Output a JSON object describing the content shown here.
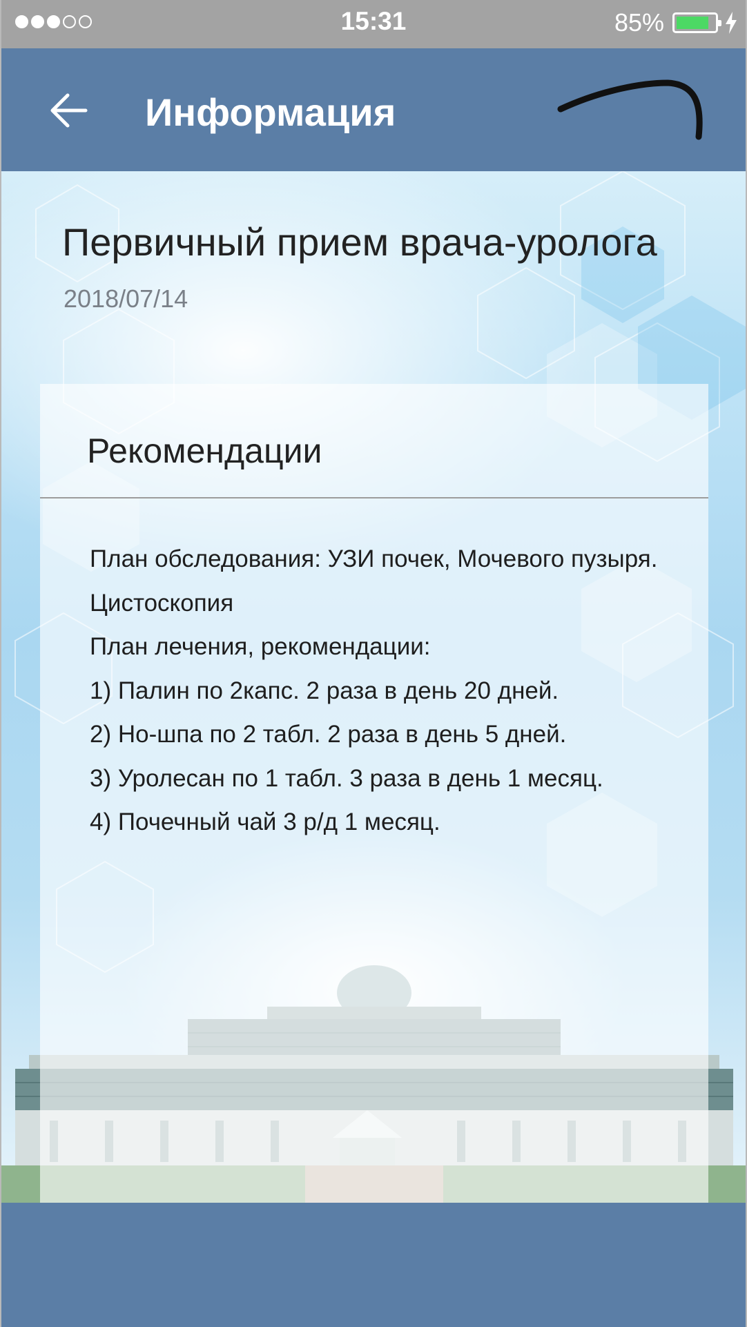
{
  "status_bar": {
    "time": "15:31",
    "battery_percent": "85%",
    "battery_level": 0.85,
    "signal_bars_filled": 3,
    "signal_bars_total": 5
  },
  "header": {
    "title": "Информация",
    "back_icon": "arrow-left-icon"
  },
  "document": {
    "title": "Первичный прием врача-уролога",
    "date": "2018/07/14"
  },
  "recommendations": {
    "heading": "Рекомендации",
    "lines": [
      "План обследования: УЗИ почек, Мочевого пузыря.",
      "Цистоскопия",
      "План лечения, рекомендации:",
      "1) Палин по 2капс. 2 раза в день 20 дней.",
      "2) Но-шпа по 2 табл. 2 раза в день 5 дней.",
      "3) Уролесан по 1 табл. 3 раза в день 1 месяц.",
      "4) Почечный чай 3 р/д 1 месяц."
    ]
  },
  "colors": {
    "header_bg": "#5b7ea6",
    "status_bar_bg": "#a3a3a3",
    "battery_fill": "#4cd964"
  }
}
